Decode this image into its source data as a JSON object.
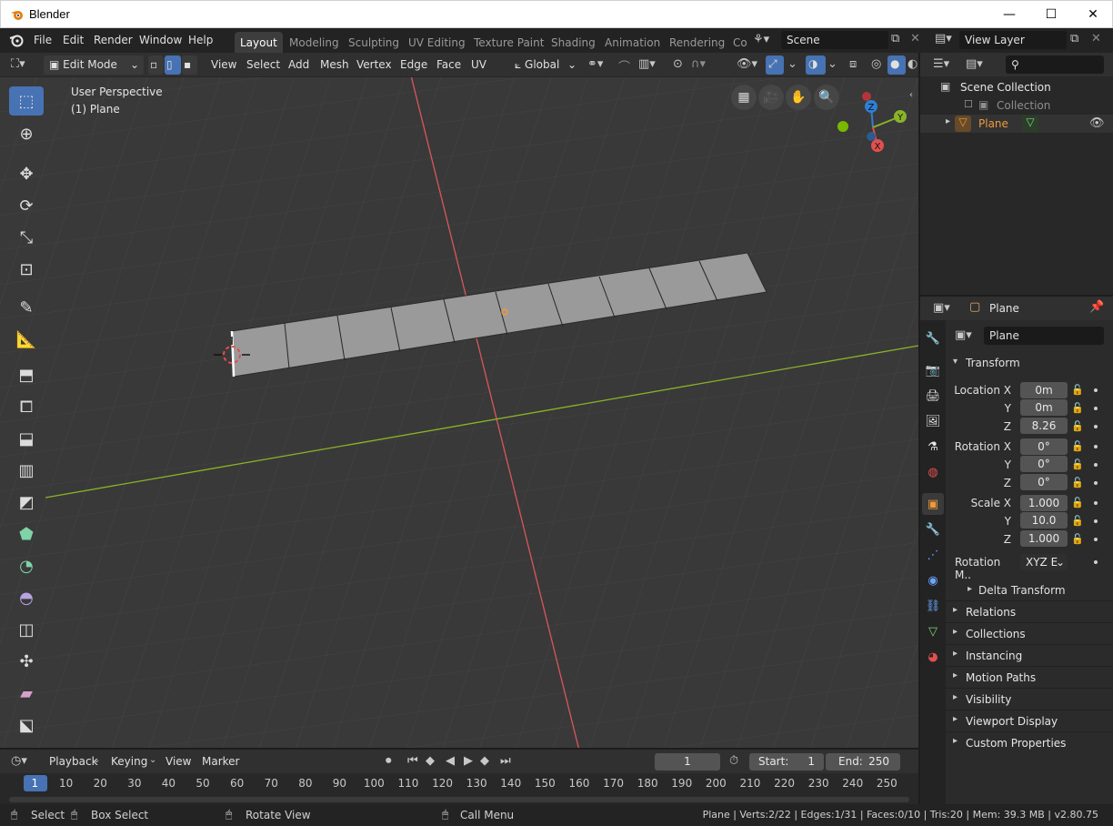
{
  "window": {
    "title": "Blender"
  },
  "menu": [
    "File",
    "Edit",
    "Render",
    "Window",
    "Help"
  ],
  "workspaces": [
    {
      "label": "Layout",
      "active": true
    },
    {
      "label": "Modeling"
    },
    {
      "label": "Sculpting"
    },
    {
      "label": "UV Editing"
    },
    {
      "label": "Texture Paint"
    },
    {
      "label": "Shading"
    },
    {
      "label": "Animation"
    },
    {
      "label": "Rendering"
    },
    {
      "label": "Co"
    }
  ],
  "scene": {
    "name": "Scene"
  },
  "view_layer": {
    "name": "View Layer"
  },
  "viewport_header": {
    "mode": "Edit Mode",
    "menus": [
      "View",
      "Select",
      "Add",
      "Mesh",
      "Vertex",
      "Edge",
      "Face",
      "UV"
    ],
    "orientation": "Global"
  },
  "viewport": {
    "perspective_label": "User Perspective",
    "object_label": "(1) Plane",
    "gizmo": {
      "z": "Z",
      "y": "Y",
      "x": "X"
    }
  },
  "outliner": {
    "rows": [
      {
        "label": "Scene Collection"
      },
      {
        "label": "Collection"
      },
      {
        "label": "Plane"
      }
    ]
  },
  "properties": {
    "header_object": "Plane",
    "object_name": "Plane",
    "transform": {
      "title": "Transform",
      "location_label": "Location X",
      "rotation_label": "Rotation X",
      "scale_label": "Scale X",
      "y_label": "Y",
      "z_label": "Z",
      "location": [
        "0m",
        "0m",
        "8.26"
      ],
      "rotation": [
        "0°",
        "0°",
        "0°"
      ],
      "scale": [
        "1.000",
        "10.0",
        "1.000"
      ],
      "rotation_mode_label": "Rotation M..",
      "rotation_mode": "XYZ E",
      "delta": "Delta Transform"
    },
    "panels": [
      "Relations",
      "Collections",
      "Instancing",
      "Motion Paths",
      "Visibility",
      "Viewport Display",
      "Custom Properties"
    ]
  },
  "timeline": {
    "menus": [
      "Playback",
      "Keying",
      "View",
      "Marker"
    ],
    "current_frame": "1",
    "start_label": "Start:",
    "start": "1",
    "end_label": "End:",
    "end": "250",
    "ticks": [
      "1",
      "10",
      "20",
      "30",
      "40",
      "50",
      "60",
      "70",
      "80",
      "90",
      "100",
      "110",
      "120",
      "130",
      "140",
      "150",
      "160",
      "170",
      "180",
      "190",
      "200",
      "210",
      "220",
      "230",
      "240",
      "250"
    ]
  },
  "statusbar": {
    "select": "Select",
    "box_select": "Box Select",
    "rotate_view": "Rotate View",
    "call_menu": "Call Menu",
    "stats": "Plane | Verts:2/22 | Edges:1/31 | Faces:0/10 | Tris:20 | Mem: 39.3 MB | v2.80.75"
  },
  "colors": {
    "accent": "#4772b3",
    "axis_x": "#e0504f",
    "axis_y": "#8ab327",
    "object_orange": "#ee9a3a"
  }
}
